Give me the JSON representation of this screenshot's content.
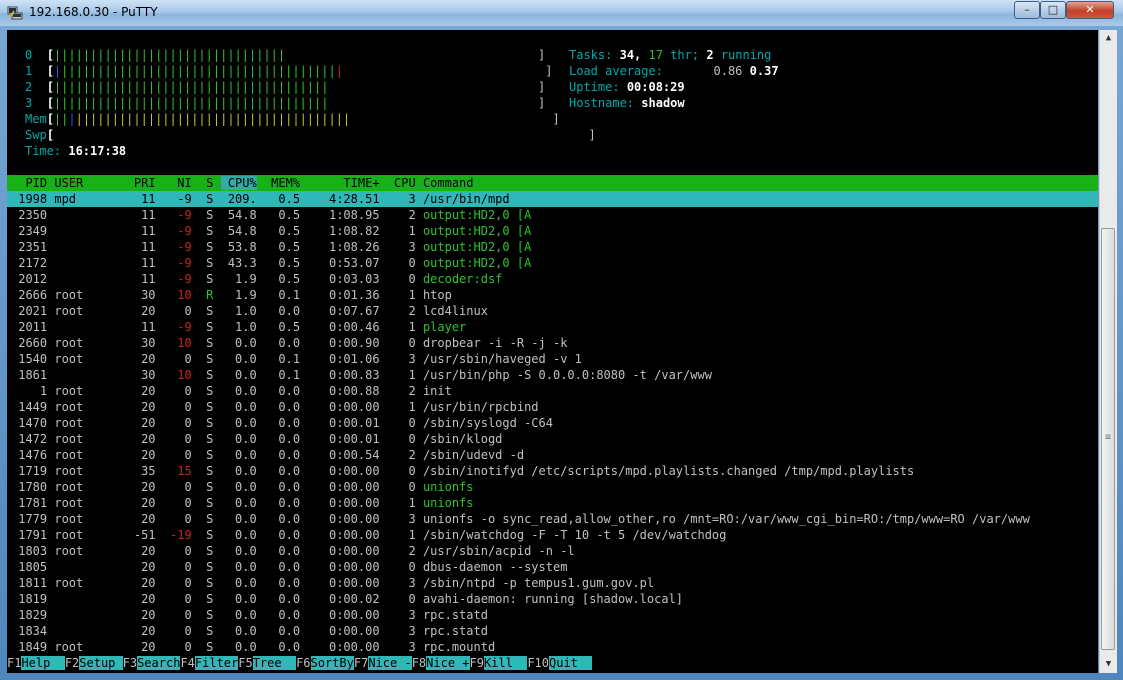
{
  "window": {
    "title": "192.168.0.30 - PuTTY",
    "min": "–",
    "max": "□",
    "close": "✕"
  },
  "meters": [
    {
      "label": "0",
      "bars": "||||||||||||||||||||||||||||||||",
      "close": "]"
    },
    {
      "label": "1",
      "bars": "||||||||||||||||||||||||||||||||||||||",
      "close": "]"
    },
    {
      "label": "2",
      "bars": "||||||||||||||||||||||||||||||||||||||",
      "close": "]"
    },
    {
      "label": "3",
      "bars": "||||||||||||||||||||||||||||||||||||||",
      "close": "]"
    },
    {
      "label": "Mem",
      "bars": "||||||||||||||||||||||||||||||||||||||",
      "close": "]"
    },
    {
      "label": "Swp",
      "bars": "",
      "close": "]"
    }
  ],
  "time": {
    "label": "Time:",
    "value": "16:17:38"
  },
  "summary": {
    "tasks_label": "Tasks:",
    "tasks": "34,",
    "thr": "17",
    "thr_label": "thr;",
    "running": "2",
    "running_label": "running",
    "load_label": "Load average:",
    "load1": "0.86",
    "load2": "0.37",
    "uptime_label": "Uptime:",
    "uptime": "00:08:29",
    "hostname_label": "Hostname:",
    "hostname": "shadow"
  },
  "table": {
    "headers": {
      "pid": "PID",
      "user": "USER",
      "pri": "PRI",
      "ni": "NI",
      "s": "S",
      "cpu": "CPU%",
      "mem": "MEM%",
      "time": "TIME+",
      "cpun": "CPU",
      "cmd": "Command"
    },
    "rows": [
      {
        "pid": "1998",
        "user": "mpd",
        "pri": "11",
        "ni": "-9",
        "s": "S",
        "cpu": "209.",
        "mem": "0.5",
        "time": "4:28.51",
        "cpun": "3",
        "cmd": "/usr/bin/mpd"
      },
      {
        "pid": "2350",
        "user": "",
        "pri": "11",
        "ni": "-9",
        "s": "S",
        "cpu": "54.8",
        "mem": "0.5",
        "time": "1:08.95",
        "cpun": "2",
        "cmd": "output:HD2,0 [A"
      },
      {
        "pid": "2349",
        "user": "",
        "pri": "11",
        "ni": "-9",
        "s": "S",
        "cpu": "54.8",
        "mem": "0.5",
        "time": "1:08.82",
        "cpun": "1",
        "cmd": "output:HD2,0 [A"
      },
      {
        "pid": "2351",
        "user": "",
        "pri": "11",
        "ni": "-9",
        "s": "S",
        "cpu": "53.8",
        "mem": "0.5",
        "time": "1:08.26",
        "cpun": "3",
        "cmd": "output:HD2,0 [A"
      },
      {
        "pid": "2172",
        "user": "",
        "pri": "11",
        "ni": "-9",
        "s": "S",
        "cpu": "43.3",
        "mem": "0.5",
        "time": "0:53.07",
        "cpun": "0",
        "cmd": "output:HD2,0 [A"
      },
      {
        "pid": "2012",
        "user": "",
        "pri": "11",
        "ni": "-9",
        "s": "S",
        "cpu": "1.9",
        "mem": "0.5",
        "time": "0:03.03",
        "cpun": "0",
        "cmd": "decoder:dsf"
      },
      {
        "pid": "2666",
        "user": "root",
        "pri": "30",
        "ni": "10",
        "s": "R",
        "cpu": "1.9",
        "mem": "0.1",
        "time": "0:01.36",
        "cpun": "1",
        "cmd": "htop"
      },
      {
        "pid": "2021",
        "user": "root",
        "pri": "20",
        "ni": "0",
        "s": "S",
        "cpu": "1.0",
        "mem": "0.0",
        "time": "0:07.67",
        "cpun": "2",
        "cmd": "lcd4linux"
      },
      {
        "pid": "2011",
        "user": "",
        "pri": "11",
        "ni": "-9",
        "s": "S",
        "cpu": "1.0",
        "mem": "0.5",
        "time": "0:00.46",
        "cpun": "1",
        "cmd": "player"
      },
      {
        "pid": "2660",
        "user": "root",
        "pri": "30",
        "ni": "10",
        "s": "S",
        "cpu": "0.0",
        "mem": "0.0",
        "time": "0:00.90",
        "cpun": "0",
        "cmd": "dropbear -i -R -j -k"
      },
      {
        "pid": "1540",
        "user": "root",
        "pri": "20",
        "ni": "0",
        "s": "S",
        "cpu": "0.0",
        "mem": "0.1",
        "time": "0:01.06",
        "cpun": "3",
        "cmd": "/usr/sbin/haveged -v 1"
      },
      {
        "pid": "1861",
        "user": "",
        "pri": "30",
        "ni": "10",
        "s": "S",
        "cpu": "0.0",
        "mem": "0.1",
        "time": "0:00.83",
        "cpun": "1",
        "cmd": "/usr/bin/php -S 0.0.0.0:8080 -t /var/www"
      },
      {
        "pid": "1",
        "user": "root",
        "pri": "20",
        "ni": "0",
        "s": "S",
        "cpu": "0.0",
        "mem": "0.0",
        "time": "0:00.88",
        "cpun": "2",
        "cmd": "init"
      },
      {
        "pid": "1449",
        "user": "root",
        "pri": "20",
        "ni": "0",
        "s": "S",
        "cpu": "0.0",
        "mem": "0.0",
        "time": "0:00.00",
        "cpun": "1",
        "cmd": "/usr/bin/rpcbind"
      },
      {
        "pid": "1470",
        "user": "root",
        "pri": "20",
        "ni": "0",
        "s": "S",
        "cpu": "0.0",
        "mem": "0.0",
        "time": "0:00.01",
        "cpun": "0",
        "cmd": "/sbin/syslogd -C64"
      },
      {
        "pid": "1472",
        "user": "root",
        "pri": "20",
        "ni": "0",
        "s": "S",
        "cpu": "0.0",
        "mem": "0.0",
        "time": "0:00.01",
        "cpun": "0",
        "cmd": "/sbin/klogd"
      },
      {
        "pid": "1476",
        "user": "root",
        "pri": "20",
        "ni": "0",
        "s": "S",
        "cpu": "0.0",
        "mem": "0.0",
        "time": "0:00.54",
        "cpun": "2",
        "cmd": "/sbin/udevd -d"
      },
      {
        "pid": "1719",
        "user": "root",
        "pri": "35",
        "ni": "15",
        "s": "S",
        "cpu": "0.0",
        "mem": "0.0",
        "time": "0:00.00",
        "cpun": "0",
        "cmd": "/sbin/inotifyd /etc/scripts/mpd.playlists.changed /tmp/mpd.playlists"
      },
      {
        "pid": "1780",
        "user": "root",
        "pri": "20",
        "ni": "0",
        "s": "S",
        "cpu": "0.0",
        "mem": "0.0",
        "time": "0:00.00",
        "cpun": "0",
        "cmd": "unionfs"
      },
      {
        "pid": "1781",
        "user": "root",
        "pri": "20",
        "ni": "0",
        "s": "S",
        "cpu": "0.0",
        "mem": "0.0",
        "time": "0:00.00",
        "cpun": "1",
        "cmd": "unionfs"
      },
      {
        "pid": "1779",
        "user": "root",
        "pri": "20",
        "ni": "0",
        "s": "S",
        "cpu": "0.0",
        "mem": "0.0",
        "time": "0:00.00",
        "cpun": "3",
        "cmd": "unionfs -o sync_read,allow_other,ro /mnt=RO:/var/www_cgi_bin=RO:/tmp/www=RO /var/www"
      },
      {
        "pid": "1791",
        "user": "root",
        "pri": "-51",
        "ni": "-19",
        "s": "S",
        "cpu": "0.0",
        "mem": "0.0",
        "time": "0:00.00",
        "cpun": "1",
        "cmd": "/sbin/watchdog -F -T 10 -t 5 /dev/watchdog"
      },
      {
        "pid": "1803",
        "user": "root",
        "pri": "20",
        "ni": "0",
        "s": "S",
        "cpu": "0.0",
        "mem": "0.0",
        "time": "0:00.00",
        "cpun": "2",
        "cmd": "/usr/sbin/acpid -n -l"
      },
      {
        "pid": "1805",
        "user": "",
        "pri": "20",
        "ni": "0",
        "s": "S",
        "cpu": "0.0",
        "mem": "0.0",
        "time": "0:00.00",
        "cpun": "0",
        "cmd": "dbus-daemon --system"
      },
      {
        "pid": "1811",
        "user": "root",
        "pri": "20",
        "ni": "0",
        "s": "S",
        "cpu": "0.0",
        "mem": "0.0",
        "time": "0:00.00",
        "cpun": "3",
        "cmd": "/sbin/ntpd -p tempus1.gum.gov.pl"
      },
      {
        "pid": "1819",
        "user": "",
        "pri": "20",
        "ni": "0",
        "s": "S",
        "cpu": "0.0",
        "mem": "0.0",
        "time": "0:00.02",
        "cpun": "0",
        "cmd": "avahi-daemon: running [shadow.local]"
      },
      {
        "pid": "1829",
        "user": "",
        "pri": "20",
        "ni": "0",
        "s": "S",
        "cpu": "0.0",
        "mem": "0.0",
        "time": "0:00.00",
        "cpun": "3",
        "cmd": "rpc.statd"
      },
      {
        "pid": "1834",
        "user": "",
        "pri": "20",
        "ni": "0",
        "s": "S",
        "cpu": "0.0",
        "mem": "0.0",
        "time": "0:00.00",
        "cpun": "3",
        "cmd": "rpc.statd"
      },
      {
        "pid": "1849",
        "user": "root",
        "pri": "20",
        "ni": "0",
        "s": "S",
        "cpu": "0.0",
        "mem": "0.0",
        "time": "0:00.00",
        "cpun": "3",
        "cmd": "rpc.mountd"
      }
    ]
  },
  "footer": [
    {
      "key": "F1",
      "label": "Help  "
    },
    {
      "key": "F2",
      "label": "Setup "
    },
    {
      "key": "F3",
      "label": "Search"
    },
    {
      "key": "F4",
      "label": "Filter"
    },
    {
      "key": "F5",
      "label": "Tree  "
    },
    {
      "key": "F6",
      "label": "SortBy"
    },
    {
      "key": "F7",
      "label": "Nice -"
    },
    {
      "key": "F8",
      "label": "Nice +"
    },
    {
      "key": "F9",
      "label": "Kill  "
    },
    {
      "key": "F10",
      "label": "Quit  "
    }
  ],
  "scrollbar": {
    "up": "▲",
    "down": "▼",
    "grip": "≡"
  },
  "colors": {
    "header_bg": "#18b218",
    "selected_bg": "#30b8b8",
    "terminal_bg": "#000000"
  }
}
